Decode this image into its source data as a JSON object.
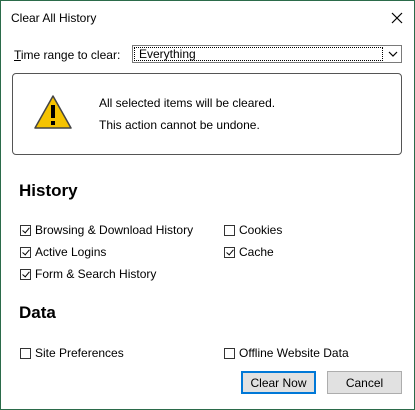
{
  "dialog": {
    "title": "Clear All History",
    "close_icon": "close-icon"
  },
  "time_range": {
    "label_accel": "T",
    "label_rest": "ime range to clear:",
    "selected": "Everything"
  },
  "warning": {
    "icon": "warning-icon",
    "line1": "All selected items will be cleared.",
    "line2": "This action cannot be undone."
  },
  "history": {
    "heading": "History",
    "items": [
      {
        "label": "Browsing & Download History",
        "checked": true
      },
      {
        "label": "Active Logins",
        "checked": true
      },
      {
        "label": "Form & Search History",
        "checked": true
      },
      {
        "label": "Cookies",
        "checked": false
      },
      {
        "label": "Cache",
        "checked": true
      }
    ]
  },
  "data": {
    "heading": "Data",
    "items": [
      {
        "label": "Site Preferences",
        "checked": false
      },
      {
        "label": "Offline Website Data",
        "checked": false
      }
    ]
  },
  "buttons": {
    "clear_now": "Clear Now",
    "cancel": "Cancel"
  },
  "colors": {
    "window_border": "#2b6b4a",
    "focus_border": "#0078d7",
    "warning_yellow": "#f5c300"
  }
}
